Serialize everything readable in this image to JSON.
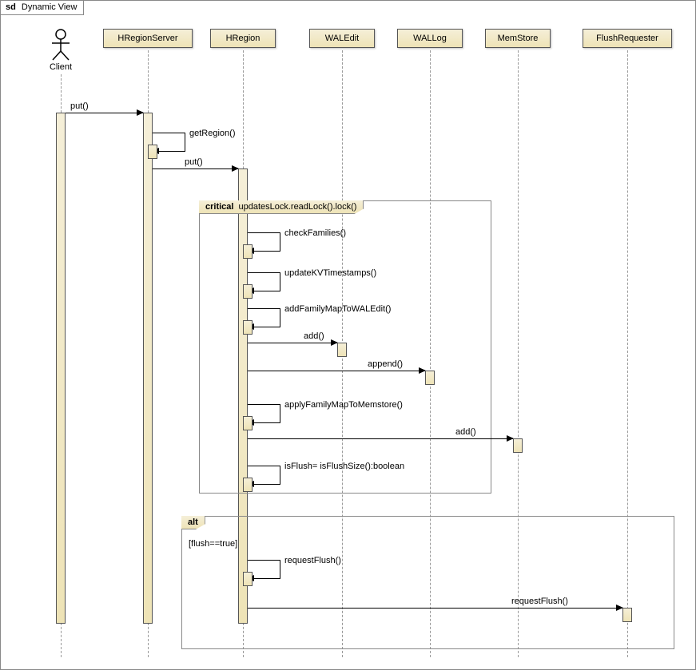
{
  "frame": {
    "tag_prefix": "sd",
    "title": "Dynamic View"
  },
  "participants": {
    "client": "Client",
    "hregionserver": "HRegionServer",
    "hregion": "HRegion",
    "waledit": "WALEdit",
    "wallog": "WALLog",
    "memstore": "MemStore",
    "flushrequester": "FlushRequester"
  },
  "messages": {
    "put1": "put()",
    "getRegion": "getRegion()",
    "put2": "put()",
    "checkFamilies": "checkFamilies()",
    "updateKVTimestamps": "updateKVTimestamps()",
    "addFamilyMapToWALEdit": "addFamilyMapToWALEdit()",
    "add_waledit": "add()",
    "append_wallog": "append()",
    "applyFamilyMapToMemstore": "applyFamilyMapToMemstore()",
    "add_memstore": "add()",
    "isFlush": "isFlush= isFlushSize():boolean",
    "requestFlush_self": "requestFlush()",
    "requestFlush_call": "requestFlush()"
  },
  "fragments": {
    "critical": {
      "op": "critical",
      "text": "updatesLock.readLock().lock()"
    },
    "alt": {
      "op": "alt",
      "guard": "[flush==true]"
    }
  },
  "chart_data": {
    "type": "sequence_diagram",
    "title": "sd Dynamic View",
    "participants": [
      "Client",
      "HRegionServer",
      "HRegion",
      "WALEdit",
      "WALLog",
      "MemStore",
      "FlushRequester"
    ],
    "actor_participants": [
      "Client"
    ],
    "messages": [
      {
        "from": "Client",
        "to": "HRegionServer",
        "label": "put()",
        "type": "sync"
      },
      {
        "from": "HRegionServer",
        "to": "HRegionServer",
        "label": "getRegion()",
        "type": "self"
      },
      {
        "from": "HRegionServer",
        "to": "HRegion",
        "label": "put()",
        "type": "sync"
      },
      {
        "fragment": "critical",
        "text": "updatesLock.readLock().lock()",
        "children": [
          {
            "from": "HRegion",
            "to": "HRegion",
            "label": "checkFamilies()",
            "type": "self"
          },
          {
            "from": "HRegion",
            "to": "HRegion",
            "label": "updateKVTimestamps()",
            "type": "self"
          },
          {
            "from": "HRegion",
            "to": "HRegion",
            "label": "addFamilyMapToWALEdit()",
            "type": "self"
          },
          {
            "from": "HRegion",
            "to": "WALEdit",
            "label": "add()",
            "type": "sync"
          },
          {
            "from": "HRegion",
            "to": "WALLog",
            "label": "append()",
            "type": "sync"
          },
          {
            "from": "HRegion",
            "to": "HRegion",
            "label": "applyFamilyMapToMemstore()",
            "type": "self"
          },
          {
            "from": "HRegion",
            "to": "MemStore",
            "label": "add()",
            "type": "sync"
          },
          {
            "from": "HRegion",
            "to": "HRegion",
            "label": "isFlush= isFlushSize():boolean",
            "type": "self"
          }
        ]
      },
      {
        "fragment": "alt",
        "guard": "[flush==true]",
        "children": [
          {
            "from": "HRegion",
            "to": "HRegion",
            "label": "requestFlush()",
            "type": "self"
          },
          {
            "from": "HRegion",
            "to": "FlushRequester",
            "label": "requestFlush()",
            "type": "sync"
          }
        ]
      }
    ]
  }
}
